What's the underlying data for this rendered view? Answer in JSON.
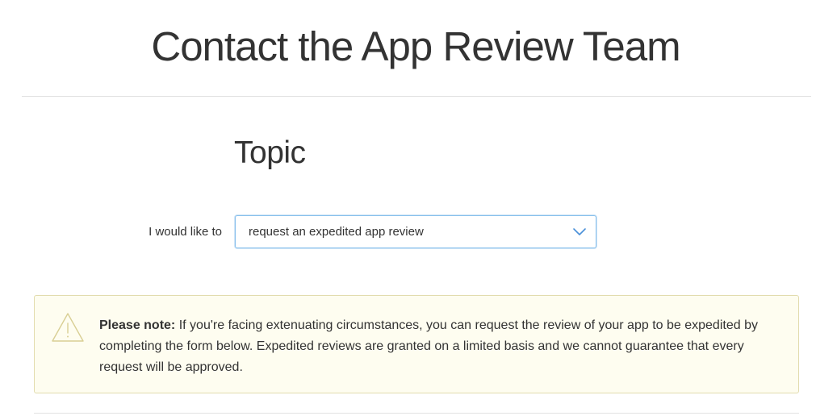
{
  "header": {
    "title": "Contact the App Review Team"
  },
  "topic": {
    "section_title": "Topic",
    "label": "I would like to",
    "selected_value": "request an expedited app review"
  },
  "notice": {
    "strong": "Please note:",
    "text": " If you're facing extenuating circumstances, you can request the review of your app to be expedited by completing the form below. Expedited reviews are granted on a limited basis and we cannot guarantee that every request will be approved.",
    "icon": "warning-triangle-icon"
  },
  "colors": {
    "select_border": "#88c0ec",
    "chevron": "#4a90d9",
    "notice_bg": "#fefdf0",
    "notice_border": "#e2dcae",
    "warning_icon": "#d9cf94"
  }
}
